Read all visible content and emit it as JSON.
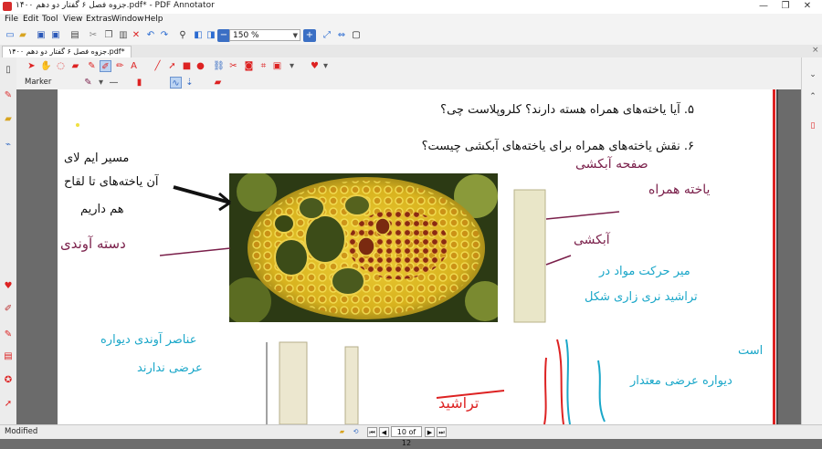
{
  "window": {
    "title": "جزوه فصل ۶ گفتار دو دهم ۱۴۰۰.pdf* - PDF Annotator",
    "minimize": "—",
    "maximize": "❐",
    "close": "✕"
  },
  "menu": {
    "items": [
      "File",
      "Edit",
      "Tool",
      "View",
      "Extras",
      "Window",
      "Help"
    ]
  },
  "toolbar": {
    "zoom_value": "150 %"
  },
  "tab": {
    "label": "جزوه فصل ۶ گفتار دو دهم ۱۴۰۰.pdf*",
    "close": "×"
  },
  "annotator_toolbar": {
    "marker_label": "Marker",
    "colors": {
      "red": "#e03030",
      "pen": "#7a1f4a",
      "accent": "#2f6fd6"
    }
  },
  "document": {
    "question_5": ". آیا یاخته‌های همراه هسته دارند؟ کلروپلاست چی؟",
    "question_5_number": "۵",
    "question_6": ". نقش یاخته‌های همراه برای یاخته‌های آبکشی چیست؟",
    "question_6_number": "۶",
    "handwritten": {
      "top_left": [
        "مسیر ایم لای",
        "آن یاخته‌های تا لقاح",
        "هم داریم"
      ],
      "vascular_bundle": "دسته آوندی",
      "companion_cell": "یاخته همراه",
      "sieve_plate": "صفحه آبکشی",
      "phloem_cell": "آبکشی",
      "cyan_left": [
        "عناصر آوندی دیواره",
        "عرضی ندارند"
      ],
      "cyan_right": [
        "میر حرکت مواد در",
        "تراشید نری زاری شکل",
        "است",
        "دیواره عرضی معتدار"
      ],
      "tracheid": "تراشید"
    }
  },
  "status": {
    "text": "Modified",
    "page_indicator": "10 of 12"
  }
}
